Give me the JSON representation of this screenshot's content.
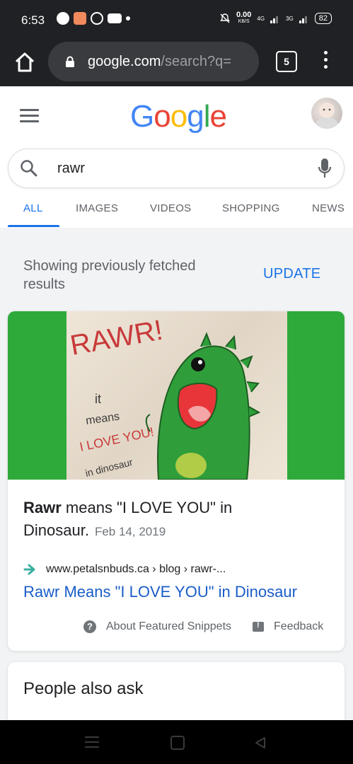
{
  "status_bar": {
    "time": "6:53",
    "data_speed": "0.00",
    "data_speed_unit": "KB/S",
    "network_1": "4G",
    "network_2": "3G",
    "battery": "82"
  },
  "browser": {
    "url_host": "google.com",
    "url_path": "/search?q=",
    "tab_count": "5"
  },
  "header": {
    "logo": [
      "G",
      "o",
      "o",
      "g",
      "l",
      "e"
    ],
    "logo_colors": [
      "#4285F4",
      "#EA4335",
      "#FBBC05",
      "#4285F4",
      "#34A853",
      "#EA4335"
    ]
  },
  "search": {
    "query": "rawr"
  },
  "tabs": [
    {
      "label": "ALL",
      "active": true
    },
    {
      "label": "IMAGES"
    },
    {
      "label": "VIDEOS"
    },
    {
      "label": "SHOPPING"
    },
    {
      "label": "NEWS"
    }
  ],
  "notice": {
    "text": "Showing previously fetched results",
    "action": "UPDATE"
  },
  "featured_snippet": {
    "image_text": {
      "line1": "RAWR!",
      "line2": "it",
      "line3": "means",
      "line4": "I LOVE YOU!",
      "line5": "in dinosaur"
    },
    "title_bold": "Rawr",
    "title_rest": " means \"I LOVE YOU\" in Dinosaur.",
    "date": "Feb 14, 2019",
    "source": "www.petalsnbuds.ca › blog › rawr-...",
    "link_title": "Rawr Means \"I LOVE YOU\" in Dinosaur",
    "about": "About Featured Snippets",
    "feedback": "Feedback"
  },
  "people_also_ask": {
    "title": "People also ask"
  },
  "colors": {
    "accent": "#1a73e8",
    "link": "#1a5dc8",
    "image_band": "#2eaa3b"
  }
}
